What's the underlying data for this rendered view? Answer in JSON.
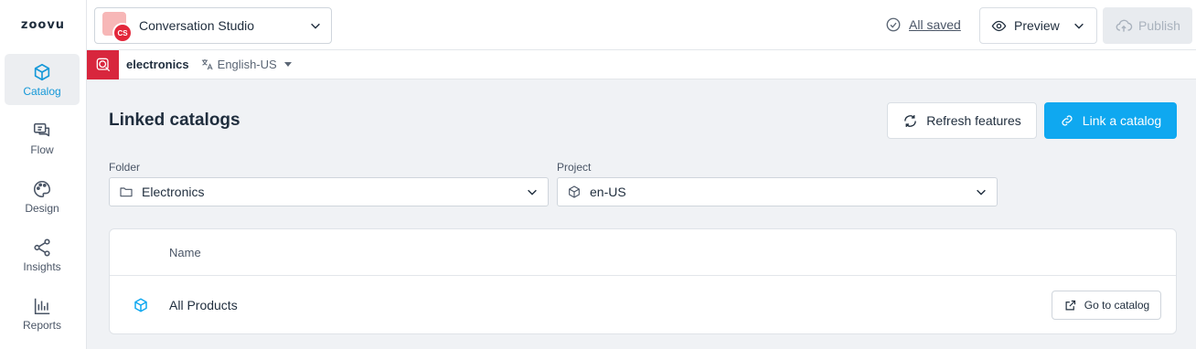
{
  "brand": {
    "logo": "zoovu"
  },
  "sidebar": {
    "items": [
      {
        "label": "Catalog",
        "icon": "cube-icon",
        "active": true
      },
      {
        "label": "Flow",
        "icon": "chat-icon"
      },
      {
        "label": "Design",
        "icon": "palette-icon"
      },
      {
        "label": "Insights",
        "icon": "share-nodes-icon"
      },
      {
        "label": "Reports",
        "icon": "bar-chart-icon"
      }
    ]
  },
  "topbar": {
    "app_name": "Conversation Studio",
    "app_badge": "CS",
    "save_status": "All saved",
    "preview_label": "Preview",
    "publish_label": "Publish"
  },
  "subbar": {
    "store_name": "electronics",
    "language": "English-US"
  },
  "main": {
    "title": "Linked catalogs",
    "refresh_label": "Refresh features",
    "link_label": "Link a catalog",
    "folder": {
      "label": "Folder",
      "value": "Electronics"
    },
    "project": {
      "label": "Project",
      "value": "en-US"
    },
    "table": {
      "columns": [
        "Name"
      ],
      "rows": [
        {
          "name": "All Products",
          "action": "Go to catalog"
        }
      ]
    }
  },
  "colors": {
    "accent": "#0fa8f0",
    "brand_red": "#d8263d"
  }
}
